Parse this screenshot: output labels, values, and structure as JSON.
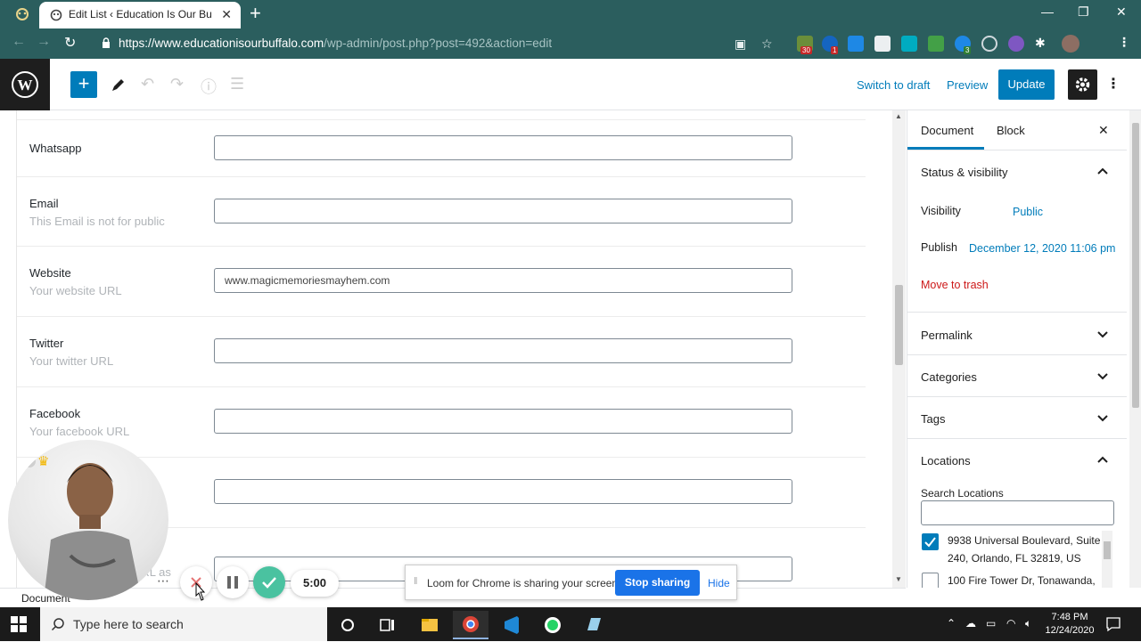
{
  "browser": {
    "tab_title": "Edit List ‹ Education Is Our Buffalo",
    "url_host": "https://www.educationisourbuffalo.com",
    "url_path": "/wp-admin/post.php?post=492&action=edit",
    "extension_badges": [
      "30",
      "1",
      "3"
    ]
  },
  "wp_header": {
    "switch_to_draft": "Switch to draft",
    "preview": "Preview",
    "update": "Update"
  },
  "fields": [
    {
      "label": "Whatsapp",
      "description": "",
      "value": ""
    },
    {
      "label": "Email",
      "description": "This Email is not for public",
      "value": ""
    },
    {
      "label": "Website",
      "description": "Your website URL",
      "value": "www.magicmemoriesmayhem.com"
    },
    {
      "label": "Twitter",
      "description": "Your twitter URL",
      "value": ""
    },
    {
      "label": "Facebook",
      "description": "Your facebook URL",
      "value": ""
    },
    {
      "label": "",
      "description": "",
      "value": ""
    },
    {
      "label": "",
      "description": "URL as",
      "value": ""
    }
  ],
  "sidebar": {
    "tabs": [
      "Document",
      "Block"
    ],
    "status_visibility": {
      "title": "Status & visibility",
      "visibility_label": "Visibility",
      "visibility_value": "Public",
      "publish_label": "Publish",
      "publish_value": "December 12, 2020 11:06 pm",
      "trash": "Move to trash"
    },
    "panels": [
      "Permalink",
      "Categories",
      "Tags"
    ],
    "locations": {
      "title": "Locations",
      "search_label": "Search Locations",
      "items": [
        {
          "text": "9938 Universal Boulevard, Suite 240, Orlando, FL 32819, US",
          "checked": true
        },
        {
          "text": "100 Fire Tower Dr, Tonawanda,",
          "checked": false
        }
      ]
    }
  },
  "status_bar": {
    "label": "Document"
  },
  "loom": {
    "timer": "5:00",
    "sharing_text": "Loom for Chrome is sharing your screen.",
    "stop_sharing": "Stop sharing",
    "hide": "Hide"
  },
  "taskbar": {
    "search_placeholder": "Type here to search",
    "time": "7:48 PM",
    "date": "12/24/2020"
  },
  "colors": {
    "chrome_frame": "#2b5e5e",
    "wp_blue": "#007cba",
    "trash_red": "#cc1818",
    "loom_green": "#4ac2a0"
  }
}
